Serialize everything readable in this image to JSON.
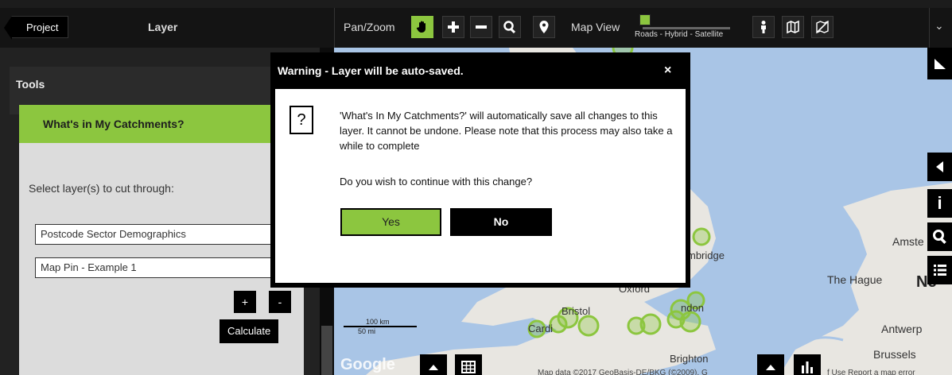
{
  "header": {
    "project_label": "Project",
    "layer_label": "Layer",
    "pan_zoom_label": "Pan/Zoom",
    "map_view_label": "Map View",
    "map_view_options": "Roads - Hybrid - Satellite",
    "map_view_selected_fraction": 0.0
  },
  "sidebar": {
    "tools_label": "Tools",
    "card_title": "What's in My Catchments?",
    "select_prompt": "Select layer(s) to cut through:",
    "layers": [
      "Postcode Sector Demographics",
      "Map Pin - Example 1"
    ],
    "add_label": "+",
    "remove_label": "-",
    "calculate_label": "Calculate"
  },
  "map": {
    "labels": {
      "cambridge": "mbridge",
      "the_hague": "The Hague",
      "amsterdam": "Amste",
      "oxford": "Oxford",
      "london": "ndon",
      "bristol": "Bristol",
      "cardiff": "Cardi",
      "antwerp": "Antwerp",
      "brighton": "Brighton",
      "brussels": "Brussels",
      "ne": "Ne"
    },
    "scale_km": "100 km",
    "scale_mi": "50 mi",
    "google": "Google",
    "attribution": "Map data ©2017 GeoBasis-DE/BKG (©2009), G",
    "terms": "f Use   Report a map error"
  },
  "dialog": {
    "title": "Warning - Layer will be auto-saved.",
    "close": "×",
    "icon": "?",
    "message": "'What's In My Catchments?' will automatically save all changes to this layer. It cannot be undone. Please note that this process may also take a while to complete",
    "question": "Do you wish to continue with this change?",
    "yes_label": "Yes",
    "no_label": "No"
  },
  "colors": {
    "accent": "#8cc63f",
    "dark": "#000000",
    "map_water": "#a9c5e6",
    "map_land": "#e8e6e1"
  }
}
